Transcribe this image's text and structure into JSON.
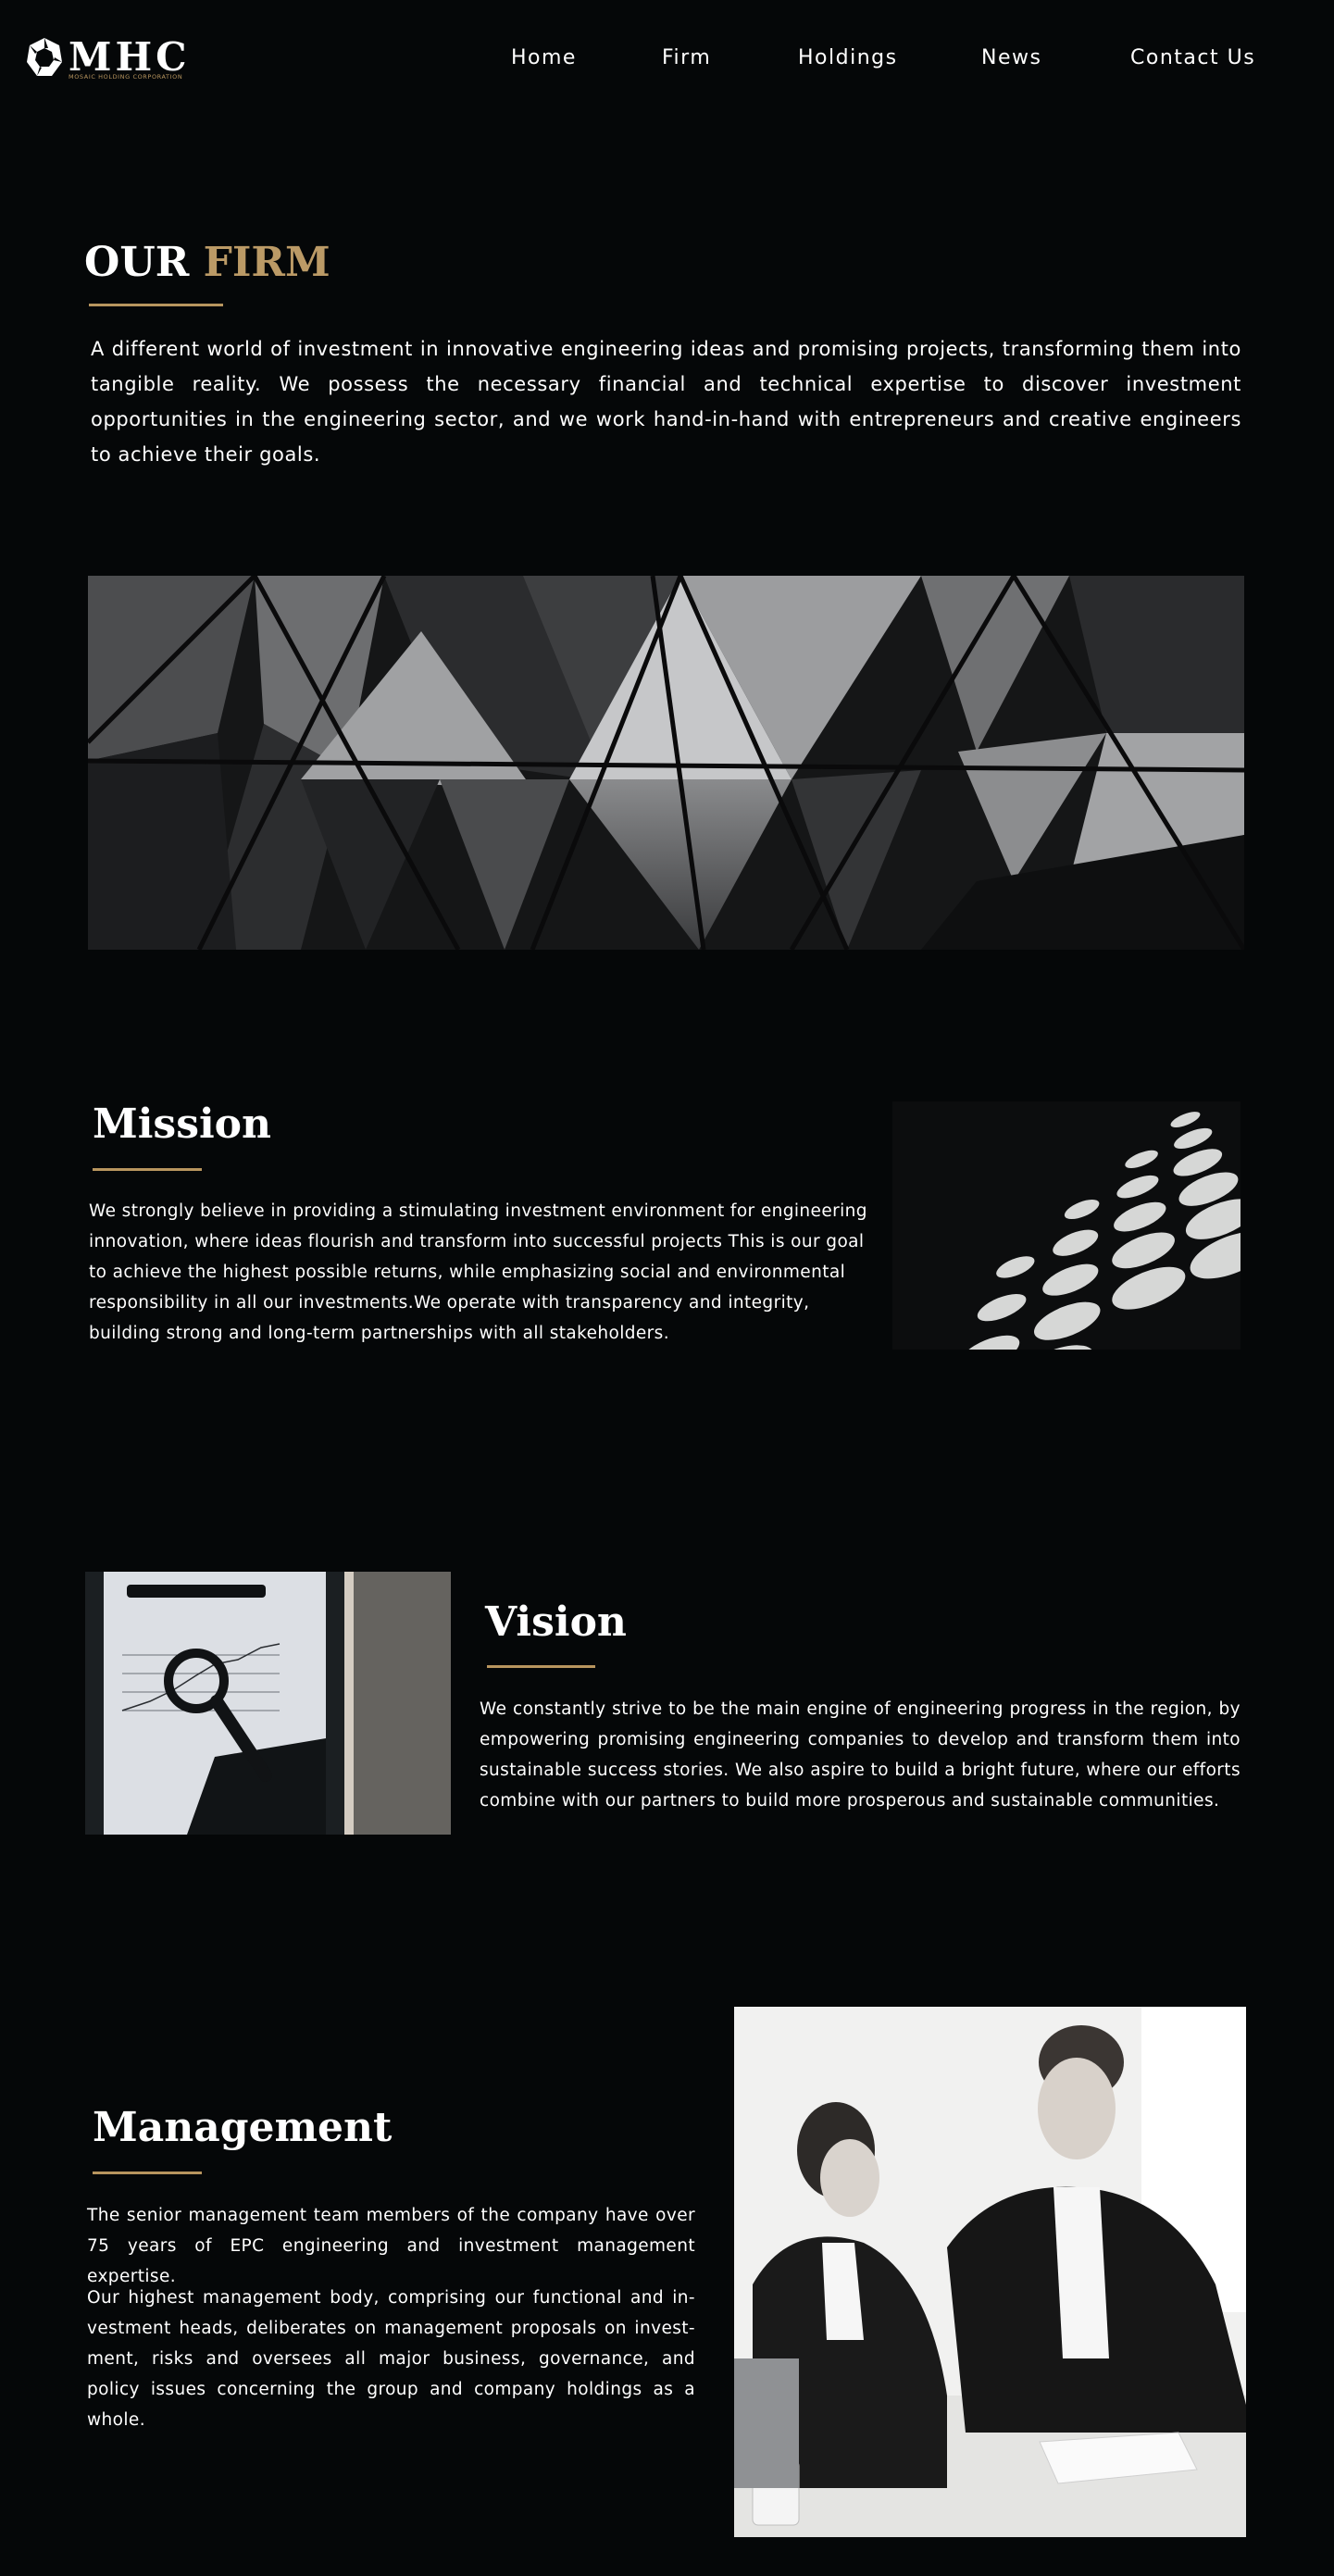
{
  "header": {
    "logo": {
      "letters": "MHC",
      "subtitle": "MOSAIC HOLDING CORPORATION",
      "icon": "mosaic-ring-icon"
    },
    "nav": [
      {
        "label": "Home"
      },
      {
        "label": "Firm"
      },
      {
        "label": "Holdings"
      },
      {
        "label": "News"
      },
      {
        "label": "Contact Us"
      }
    ]
  },
  "firm": {
    "title_part1": "OUR",
    "title_part2": "FIRM",
    "description": "A different world of investment in innovative engineering ideas and promising projects, transforming them into tangible reality. We possess the necessary financial and technical expertise to discover investment opportunities in the engineering sector, and we work hand-in-hand with entrepreneurs and creative engineers to achieve their goals."
  },
  "mission": {
    "title": "Mission",
    "text": "We strongly believe in providing a stimulating investment environment for engineering innovation, where ideas flourish and transform into successful projects This is our goal to achieve the highest possible returns, while emphasizing social and environmental responsibility in all our investments.We operate with transparency and integrity, building strong and long-term partnerships with all stakeholders."
  },
  "vision": {
    "title": "Vision",
    "text": "We constantly strive to be the main engine of engineering progress in the region, by empowering promising engineering companies to develop and transform them into sustainable success stories. We also aspire to build a bright future, where our efforts combine with our partners to build more prosperous and sustainable communities."
  },
  "management": {
    "title": "Management",
    "text1": "The senior management team members of the company have over 75 years of EPC engineering and investment management expertise.",
    "text2": "Our highest management body, comprising our functional and in-vestment heads, deliberates on management proposals on invest-ment, risks and oversees all major business, governance, and policy issues concerning the group and company holdings as a whole."
  },
  "colors": {
    "background": "#050708",
    "accent_gold": "#b8955e",
    "text": "#ffffff"
  }
}
